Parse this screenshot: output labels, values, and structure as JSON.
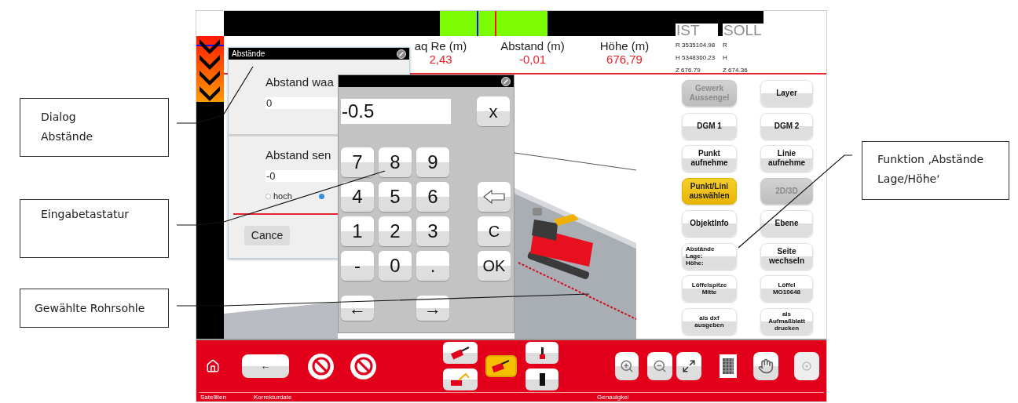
{
  "callouts_left": [
    {
      "text": "Dialog\nAbstände"
    },
    {
      "text": "Eingabetastatur"
    },
    {
      "text": "Gewählte Rohrsohle"
    }
  ],
  "callout_right": {
    "text": "Funktion ‚Abstände\nLage/Höhe‘"
  },
  "readings": [
    {
      "label": "aq Re (m)",
      "value": "2,43"
    },
    {
      "label": "Abstand (m)",
      "value": "-0,01"
    },
    {
      "label": "Höhe (m)",
      "value": "676,79"
    }
  ],
  "coordinates": [
    {
      "title": "IST",
      "values": [
        "R 3535104.98",
        "H 5348360.23",
        "Z 676.79"
      ]
    },
    {
      "title": "SOLL",
      "values": [
        "R",
        "H",
        "Z 674.36"
      ]
    }
  ],
  "dialog": {
    "title": "Abstände",
    "fields": [
      {
        "label": "Abstand waa",
        "value": "0"
      },
      {
        "label": "Abstand sen",
        "value": "-0"
      }
    ],
    "radios": [
      {
        "label": "hoch",
        "selected": false
      },
      {
        "selected": true
      }
    ],
    "cancel": "Cance"
  },
  "keypad": {
    "display": "-0.5",
    "clear": "x",
    "rows": [
      [
        "7",
        "8",
        "9"
      ],
      [
        "4",
        "5",
        "6"
      ],
      [
        "1",
        "2",
        "3"
      ],
      [
        "-",
        "0",
        "."
      ]
    ],
    "side_keys": [
      {
        "kind": "backspace"
      },
      {
        "kind": "text",
        "label": "C"
      },
      {
        "kind": "text",
        "label": "OK"
      }
    ],
    "arrows": [
      "←",
      "→"
    ]
  },
  "function_buttons": [
    {
      "label": "Gewerk\nAussengel",
      "kind": "standard",
      "disabled": true,
      "selected": false
    },
    {
      "label": "Layer",
      "kind": "standard",
      "disabled": false,
      "selected": false
    },
    {
      "label": "DGM 1",
      "kind": "standard",
      "disabled": false,
      "selected": false
    },
    {
      "label": "DGM 2",
      "kind": "standard",
      "disabled": false,
      "selected": false
    },
    {
      "label": "Punkt\naufnehme",
      "kind": "standard",
      "disabled": false,
      "selected": false
    },
    {
      "label": "Linie\naufnehme",
      "kind": "standard",
      "disabled": false,
      "selected": false
    },
    {
      "label": "Punkt/Lini\nauswählen",
      "kind": "standard",
      "disabled": false,
      "selected": true
    },
    {
      "label": "2D/3D",
      "kind": "standard",
      "disabled": true,
      "selected": false
    },
    {
      "label": "ObjektInfo",
      "kind": "standard",
      "disabled": false,
      "selected": false
    },
    {
      "label": "Ebene",
      "kind": "standard",
      "disabled": false,
      "selected": false
    },
    {
      "label": "Abstände\nLage:\nHöhe:",
      "kind": "compact",
      "disabled": false,
      "selected": false
    },
    {
      "label": "Seite\nwechseln",
      "kind": "standard",
      "disabled": false,
      "selected": false
    },
    {
      "label": "Löffelspitze\nMitte",
      "kind": "small",
      "disabled": false,
      "selected": false
    },
    {
      "label": "Löffel\nMO10648",
      "kind": "small",
      "disabled": false,
      "selected": false
    },
    {
      "label": "als dxf\nausgeben",
      "kind": "small",
      "disabled": false,
      "selected": false
    },
    {
      "label": "als\nAufmaßblatt\ndrucken",
      "kind": "small",
      "disabled": false,
      "selected": false
    }
  ],
  "bottom_bar": {
    "back": "←",
    "mode_buttons": [
      {
        "selected": false
      },
      {
        "selected": false
      },
      {
        "selected": true
      },
      {
        "selected": false
      },
      {
        "selected": false
      }
    ],
    "labels": [
      "Satelliten",
      "Korrekturdate",
      "Genauigkei"
    ]
  }
}
